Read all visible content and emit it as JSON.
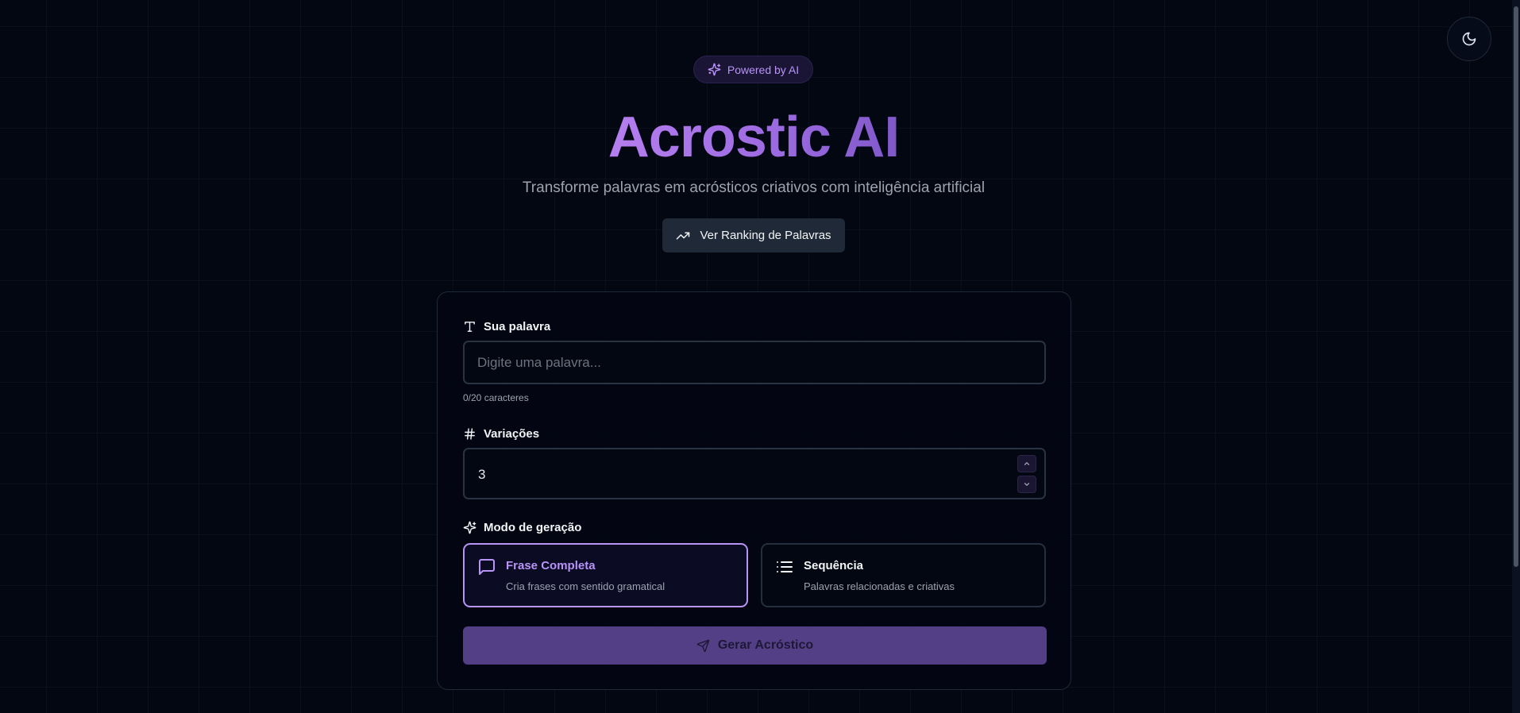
{
  "header": {
    "badge_label": "Powered by AI",
    "title": "Acrostic AI",
    "subtitle": "Transforme palavras em acrósticos criativos com inteligência artificial",
    "ranking_button_label": "Ver Ranking de Palavras"
  },
  "theme_toggle": {
    "icon": "moon-icon"
  },
  "form": {
    "word": {
      "label": "Sua palavra",
      "placeholder": "Digite uma palavra...",
      "value": "",
      "char_count": "0/20 caracteres"
    },
    "variations": {
      "label": "Variações",
      "value": "3"
    },
    "mode": {
      "label": "Modo de geração",
      "options": [
        {
          "title": "Frase Completa",
          "description": "Cria frases com sentido gramatical",
          "selected": true,
          "icon": "message-square-icon"
        },
        {
          "title": "Sequência",
          "description": "Palavras relacionadas e criativas",
          "selected": false,
          "icon": "list-icon"
        }
      ]
    },
    "submit_label": "Gerar Acróstico"
  },
  "colors": {
    "background": "#030712",
    "accent": "#b794f6",
    "button_primary": "#533f86",
    "card_border": "#1f2937"
  }
}
